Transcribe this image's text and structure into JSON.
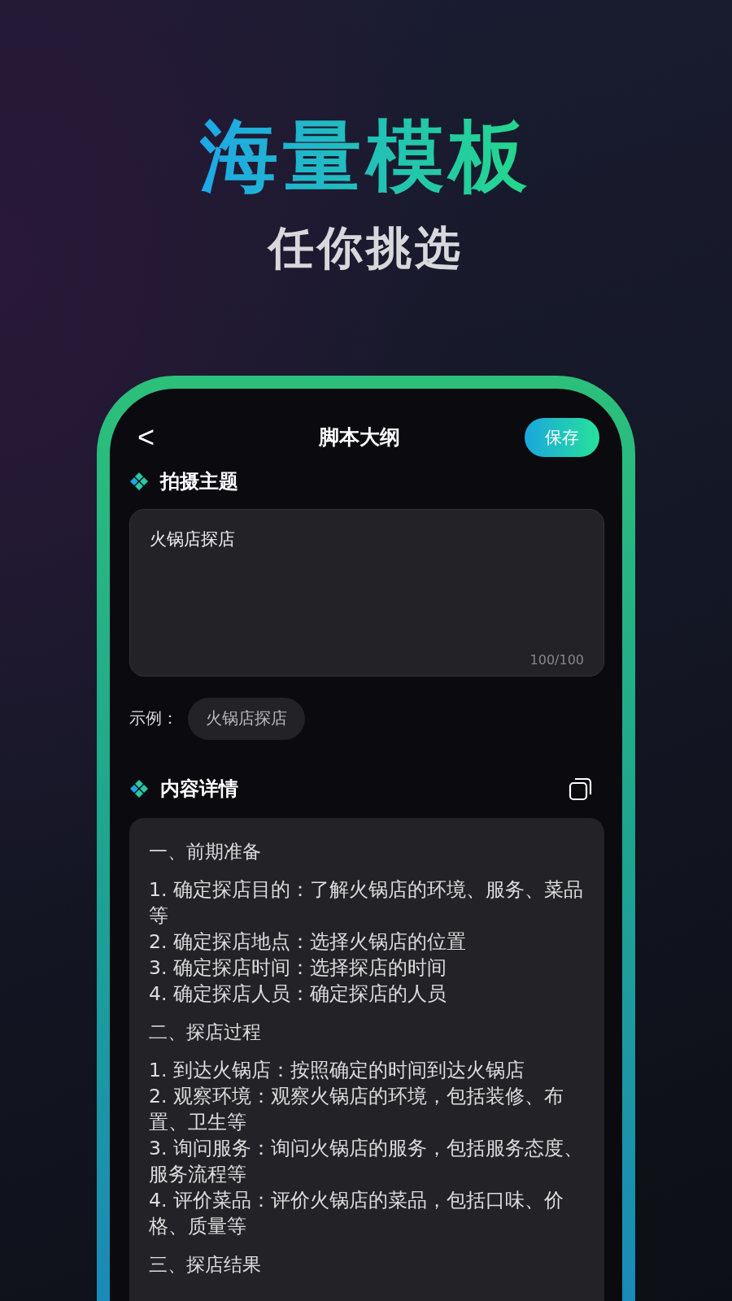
{
  "headline": "海量模板",
  "subheadline": "任你挑选",
  "phone": {
    "nav": {
      "back": "<",
      "title": "脚本大纲",
      "save_button": "保存"
    },
    "topic": {
      "title": "拍摄主题",
      "value": "火锅店探店",
      "counter": "100/100",
      "example_label": "示例：",
      "example_chip": "火锅店探店"
    },
    "details": {
      "title": "内容详情",
      "sections": [
        {
          "heading": "一、前期准备",
          "items": [
            "1. 确定探店目的：了解火锅店的环境、服务、菜品等",
            "2. 确定探店地点：选择火锅店的位置",
            "3. 确定探店时间：选择探店的时间",
            "4. 确定探店人员：确定探店的人员"
          ]
        },
        {
          "heading": "二、探店过程",
          "items": [
            "1. 到达火锅店：按照确定的时间到达火锅店",
            "2. 观察环境：观察火锅店的环境，包括装修、布置、卫生等",
            "3. 询问服务：询问火锅店的服务，包括服务态度、服务流程等",
            "4. 评价菜品：评价火锅店的菜品，包括口味、价格、质量等"
          ]
        },
        {
          "heading": "三、探店结果"
        }
      ]
    }
  }
}
